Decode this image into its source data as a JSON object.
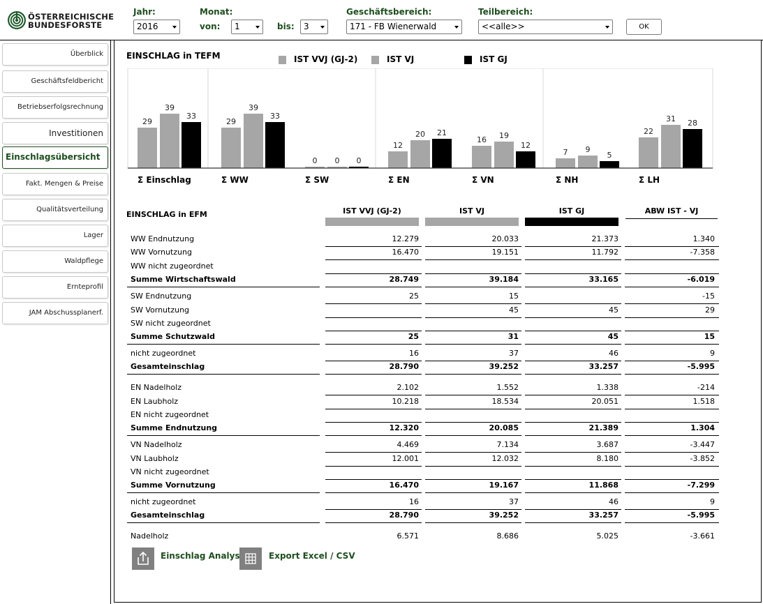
{
  "logo": {
    "line1": "ÖSTERREICHISCHE",
    "line2": "BUNDESFORSTE"
  },
  "filters": {
    "jahr_label": "Jahr:",
    "jahr_value": "2016",
    "monat_label": "Monat:",
    "von_label": "von:",
    "von_value": "1",
    "bis_label": "bis:",
    "bis_value": "3",
    "gb_label": "Geschäftsbereich:",
    "gb_value": "171 - FB Wienerwald",
    "tb_label": "Teilbereich:",
    "tb_value": "<<alle>>",
    "ok_label": "OK"
  },
  "sidebar": {
    "items": [
      {
        "label": "Überblick"
      },
      {
        "label": "Geschäftsfeldbericht"
      },
      {
        "label": "Betriebserfolgsrechnung"
      },
      {
        "label": "Investitionen"
      },
      {
        "label": "Einschlagsübersicht"
      },
      {
        "label": "Fakt. Mengen & Preise"
      },
      {
        "label": "Qualitätsverteilung"
      },
      {
        "label": "Lager"
      },
      {
        "label": "Waldpflege"
      },
      {
        "label": "Ernteprofil"
      },
      {
        "label": "JAM Abschussplanerf."
      }
    ],
    "active_index": 4
  },
  "colors": {
    "accent": "#1f4e1f",
    "vvj": "#a6a6a6",
    "vj": "#a6a6a6",
    "gj": "#000000"
  },
  "chart_data": {
    "type": "bar",
    "title": "EINSCHLAG in TEFM",
    "categories": [
      "Σ Einschlag",
      "Σ WW",
      "Σ SW",
      "Σ EN",
      "Σ VN",
      "Σ NH",
      "Σ LH"
    ],
    "series": [
      {
        "name": "IST VVJ (GJ-2)",
        "values": [
          29,
          29,
          0,
          12,
          16,
          7,
          22
        ]
      },
      {
        "name": "IST VJ",
        "values": [
          39,
          39,
          0,
          20,
          19,
          9,
          31
        ]
      },
      {
        "name": "IST GJ",
        "values": [
          33,
          33,
          0,
          21,
          12,
          5,
          28
        ]
      }
    ],
    "ylim": [
      0,
      45
    ],
    "grid": false,
    "legend": "top"
  },
  "table": {
    "title": "EINSCHLAG in EFM",
    "headers": [
      "IST VVJ (GJ-2)",
      "IST VJ",
      "IST GJ",
      "ABW IST - VJ"
    ],
    "rows": [
      {
        "label": "WW Endnutzung",
        "values": [
          "12.279",
          "20.033",
          "21.373",
          "1.340"
        ],
        "bold": false
      },
      {
        "label": "WW Vornutzung",
        "values": [
          "16.470",
          "19.151",
          "11.792",
          "-7.358"
        ],
        "bold": false
      },
      {
        "label": "WW nicht zugeordnet",
        "values": [
          "",
          "",
          "",
          ""
        ],
        "bold": false
      },
      {
        "label": "Summe Wirtschaftswald",
        "values": [
          "28.749",
          "39.184",
          "33.165",
          "-6.019"
        ],
        "bold": true
      },
      {
        "label": "SW Endnutzung",
        "values": [
          "25",
          "15",
          "",
          "-15"
        ],
        "bold": false
      },
      {
        "label": "SW Vornutzung",
        "values": [
          "",
          "45",
          "45",
          "29"
        ],
        "bold": false
      },
      {
        "label": "SW nicht zugeordnet",
        "values": [
          "",
          "",
          "",
          ""
        ],
        "bold": false
      },
      {
        "label": "Summe Schutzwald",
        "values": [
          "25",
          "31",
          "45",
          "15"
        ],
        "bold": true
      },
      {
        "label": "nicht zugeordnet",
        "values": [
          "16",
          "37",
          "46",
          "9"
        ],
        "bold": false
      },
      {
        "label": "Gesamteinschlag",
        "values": [
          "28.790",
          "39.252",
          "33.257",
          "-5.995"
        ],
        "bold": true
      },
      {
        "label": "EN Nadelholz",
        "values": [
          "2.102",
          "1.552",
          "1.338",
          "-214"
        ],
        "bold": false
      },
      {
        "label": "EN Laubholz",
        "values": [
          "10.218",
          "18.534",
          "20.051",
          "1.518"
        ],
        "bold": false
      },
      {
        "label": "EN nicht zugeordnet",
        "values": [
          "",
          "",
          "",
          ""
        ],
        "bold": false
      },
      {
        "label": "Summe Endnutzung",
        "values": [
          "12.320",
          "20.085",
          "21.389",
          "1.304"
        ],
        "bold": true
      },
      {
        "label": "VN Nadelholz",
        "values": [
          "4.469",
          "7.134",
          "3.687",
          "-3.447"
        ],
        "bold": false
      },
      {
        "label": "VN Laubholz",
        "values": [
          "12.001",
          "12.032",
          "8.180",
          "-3.852"
        ],
        "bold": false
      },
      {
        "label": "VN nicht zugeordnet",
        "values": [
          "",
          "",
          "",
          ""
        ],
        "bold": false
      },
      {
        "label": "Summe Vornutzung",
        "values": [
          "16.470",
          "19.167",
          "11.868",
          "-7.299"
        ],
        "bold": true
      },
      {
        "label": "nicht zugeordnet",
        "values": [
          "16",
          "37",
          "46",
          "9"
        ],
        "bold": false
      },
      {
        "label": "Gesamteinschlag",
        "values": [
          "28.790",
          "39.252",
          "33.257",
          "-5.995"
        ],
        "bold": true
      },
      {
        "label": "Nadelholz",
        "values": [
          "6.571",
          "8.686",
          "5.025",
          "-3.661"
        ],
        "bold": false
      }
    ]
  },
  "actions": {
    "analyse_label": "Einschlag Analyse",
    "export_label": "Export Excel / CSV"
  }
}
